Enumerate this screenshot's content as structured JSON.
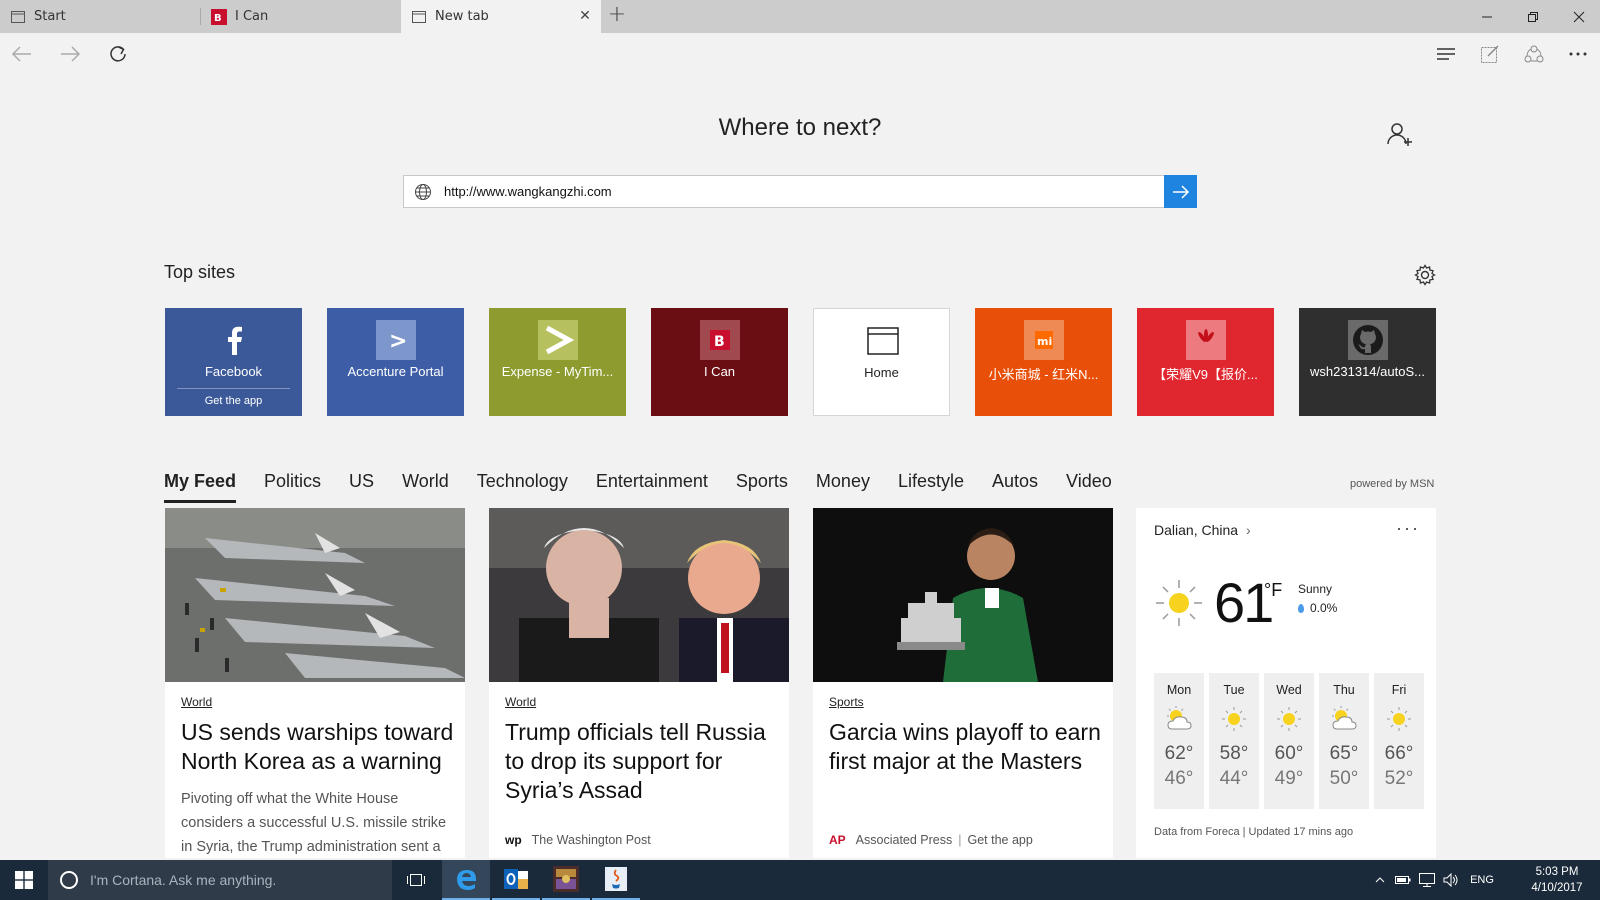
{
  "tabs": [
    {
      "label": "Start",
      "icon": "page-icon"
    },
    {
      "label": "I Can",
      "icon": "b3-icon"
    },
    {
      "label": "New tab",
      "icon": "page-icon"
    }
  ],
  "page": {
    "heading": "Where to next?",
    "search_value": "http://www.wangkangzhi.com"
  },
  "top_sites": {
    "title": "Top sites",
    "tiles": [
      {
        "label": "Facebook",
        "sub": "Get the app",
        "color": "#3b5998"
      },
      {
        "label": "Accenture Portal",
        "color": "#3d5da6"
      },
      {
        "label": "Expense - MyTim...",
        "color": "#8e9b2f"
      },
      {
        "label": "I Can",
        "color": "#6b0e14"
      },
      {
        "label": "Home",
        "color": "#ffffff"
      },
      {
        "label": "小米商城 - 红米N...",
        "color": "#e8500a"
      },
      {
        "label": "【荣耀V9【报价...",
        "color": "#e0262e"
      },
      {
        "label": "wsh231314/autoS...",
        "color": "#2f2f2f"
      }
    ]
  },
  "feed": {
    "tabs": [
      "My Feed",
      "Politics",
      "US",
      "World",
      "Technology",
      "Entertainment",
      "Sports",
      "Money",
      "Lifestyle",
      "Autos",
      "Video"
    ],
    "powered": "powered by MSN",
    "cards": [
      {
        "category": "World",
        "headline": "US sends warships toward North Korea as a warning",
        "summary": "Pivoting off what the White House considers a successful U.S. missile strike in Syria, the Trump administration sent a"
      },
      {
        "category": "World",
        "headline": "Trump officials tell Russia to drop its support for Syria’s Assad",
        "source_logo": "wp",
        "source": "The Washington Post"
      },
      {
        "category": "Sports",
        "headline": "Garcia wins playoff to earn first major at the Masters",
        "source_logo": "AP",
        "source": "Associated Press",
        "source_extra": "Get the app"
      }
    ]
  },
  "weather": {
    "location": "Dalian, China",
    "more": "···",
    "temp": "61",
    "unit": "°F",
    "condition": "Sunny",
    "precip": "0.0%",
    "days": [
      {
        "name": "Mon",
        "hi": "62°",
        "lo": "46°",
        "icon": "partly-cloudy-icon"
      },
      {
        "name": "Tue",
        "hi": "58°",
        "lo": "44°",
        "icon": "sun-icon"
      },
      {
        "name": "Wed",
        "hi": "60°",
        "lo": "49°",
        "icon": "sun-icon"
      },
      {
        "name": "Thu",
        "hi": "65°",
        "lo": "50°",
        "icon": "partly-cloudy-icon"
      },
      {
        "name": "Fri",
        "hi": "66°",
        "lo": "52°",
        "icon": "sun-icon"
      }
    ],
    "footer": "Data from Foreca | Updated 17 mins ago"
  },
  "taskbar": {
    "cortana": "I'm Cortana. Ask me anything.",
    "lang": "ENG",
    "time": "5:03 PM",
    "date": "4/10/2017"
  }
}
